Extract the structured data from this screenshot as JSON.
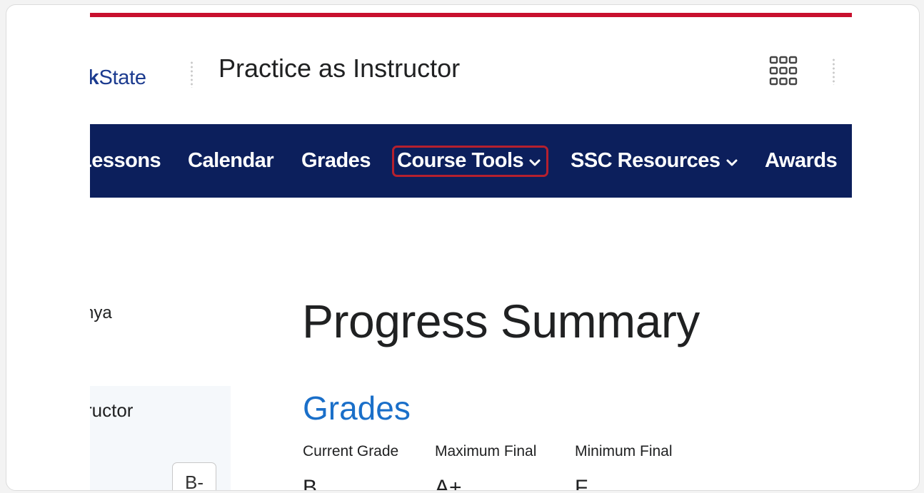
{
  "colors": {
    "stripe": "#c8102e",
    "navbar": "#0c1f5c",
    "highlight": "#b5202e",
    "link": "#1a6fc9"
  },
  "header": {
    "brand_prefix": "'k",
    "brand_suffix": "State",
    "course_title": "Practice as Instructor",
    "apps_icon": "grid-9-icon"
  },
  "nav": {
    "items": [
      {
        "label": "Lessons",
        "has_menu": false
      },
      {
        "label": "Calendar",
        "has_menu": false
      },
      {
        "label": "Grades",
        "has_menu": false
      },
      {
        "label": "Course Tools",
        "has_menu": true
      },
      {
        "label": "SSC Resources",
        "has_menu": true
      },
      {
        "label": "Awards",
        "has_menu": false
      }
    ],
    "chevron": "⌄"
  },
  "sidebar": {
    "user_name": "nya",
    "role": "ructor",
    "grade_chip": "B-"
  },
  "main": {
    "page_title": "Progress Summary",
    "section_title": "Grades",
    "grade_columns": [
      {
        "label": "Current Grade",
        "value": "B"
      },
      {
        "label": "Maximum Final",
        "value": "A+"
      },
      {
        "label": "Minimum Final",
        "value": "F"
      }
    ]
  }
}
